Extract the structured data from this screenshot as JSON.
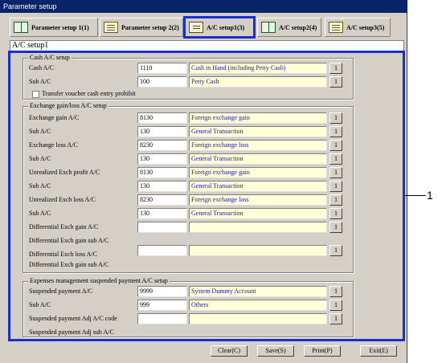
{
  "window": {
    "title": "Parameter setup"
  },
  "tabs": [
    {
      "label": "Parameter setup 1(1)",
      "icon": "book-icon"
    },
    {
      "label": "Parameter setup 2(2)",
      "icon": "page-icon"
    },
    {
      "label": "A/C setup1(3)",
      "icon": "card-icon",
      "active": true
    },
    {
      "label": "A/C setup2(4)",
      "icon": "book-icon"
    },
    {
      "label": "A/C setup3(5)",
      "icon": "page-icon"
    }
  ],
  "page_title": "A/C setup1",
  "cash": {
    "title": "Cash A/C setup",
    "cash_label": "Cash A/C",
    "cash_code": "1110",
    "cash_name": "Cash in Hand (including Petty Cash)",
    "sub_label": "Sub A/C",
    "sub_code": "100",
    "sub_name": "Petty Cash",
    "prohibit_label": "Transfer voucher cash entry prohibit"
  },
  "exchange": {
    "title": "Exchange gain/loss A/C setup",
    "rows": [
      {
        "label": "Exchange gain A/C",
        "code": "8130",
        "name": "Foreign exchange gain"
      },
      {
        "label": "Sub A/C",
        "code": "130",
        "name": "General Transaction"
      },
      {
        "label": "Exchange loss A/C",
        "code": "8230",
        "name": "Foreign exchange loss"
      },
      {
        "label": "Sub A/C",
        "code": "130",
        "name": "General Transaction"
      },
      {
        "label": "Unrealized Exch profit A/C",
        "code": "8130",
        "name": "Foreign exchange gain"
      },
      {
        "label": "Sub A/C",
        "code": "130",
        "name": "General Transaction"
      },
      {
        "label": "Unrealized Exch loss A/C",
        "code": "8230",
        "name": "Foreign exchange loss"
      },
      {
        "label": "Sub A/C",
        "code": "130",
        "name": "General Transaction"
      },
      {
        "label": "Differential Exch gain A/C",
        "code": "",
        "name": ""
      },
      {
        "label": "Differential Exch gain sub A/C"
      },
      {
        "label": "Differential Exch loss A/C",
        "code": "",
        "name": ""
      },
      {
        "label": "Differential Exch gain sub A/C"
      }
    ]
  },
  "expenses": {
    "title": "Expenses management suspended payment A/C setup",
    "rows": [
      {
        "label": "Suspended payment A/C",
        "code": "9999",
        "name": "System Dummy Account"
      },
      {
        "label": "Sub A/C",
        "code": "999",
        "name": "Others"
      },
      {
        "label": "Suspended payment Adj A/C code",
        "code": "",
        "name": ""
      },
      {
        "label": "Suspended payment Adj sub A/C"
      }
    ]
  },
  "lookup_label": "1",
  "buttons": {
    "clear": "Clear(C)",
    "save": "Save(S)",
    "print": "Print(P)",
    "exit": "Exit(E)"
  },
  "callout": "1"
}
